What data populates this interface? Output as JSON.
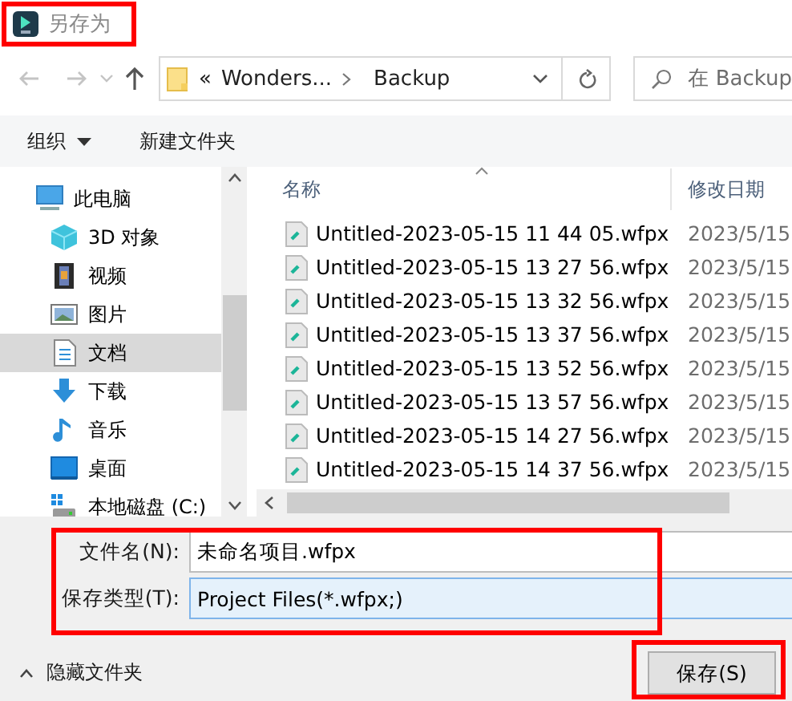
{
  "window": {
    "title": "另存为"
  },
  "navigation": {
    "overflow_marker": "«",
    "path": [
      "Wonders...",
      "Backup"
    ],
    "search": {
      "placeholder": "在 Backup"
    }
  },
  "toolbar": {
    "organize": "组织",
    "new_folder": "新建文件夹"
  },
  "sidebar": {
    "items": [
      {
        "label": "此电脑",
        "kind": "computer",
        "selected": false,
        "children": [
          {
            "label": "3D 对象",
            "kind": "cube",
            "selected": false
          },
          {
            "label": "视频",
            "kind": "video",
            "selected": false
          },
          {
            "label": "图片",
            "kind": "picture",
            "selected": false
          },
          {
            "label": "文档",
            "kind": "document",
            "selected": true
          },
          {
            "label": "下载",
            "kind": "download",
            "selected": false
          },
          {
            "label": "音乐",
            "kind": "music",
            "selected": false
          },
          {
            "label": "桌面",
            "kind": "desktop",
            "selected": false
          },
          {
            "label": "本地磁盘 (C:)",
            "kind": "drive",
            "selected": false
          }
        ]
      }
    ]
  },
  "file_list": {
    "columns": [
      "名称",
      "修改日期"
    ],
    "rows": [
      {
        "name": "Untitled-2023-05-15 11 44 05.wfpx",
        "modified": "2023/5/15"
      },
      {
        "name": "Untitled-2023-05-15 13 27 56.wfpx",
        "modified": "2023/5/15"
      },
      {
        "name": "Untitled-2023-05-15 13 32 56.wfpx",
        "modified": "2023/5/15"
      },
      {
        "name": "Untitled-2023-05-15 13 37 56.wfpx",
        "modified": "2023/5/15"
      },
      {
        "name": "Untitled-2023-05-15 13 52 56.wfpx",
        "modified": "2023/5/15"
      },
      {
        "name": "Untitled-2023-05-15 13 57 56.wfpx",
        "modified": "2023/5/15"
      },
      {
        "name": "Untitled-2023-05-15 14 27 56.wfpx",
        "modified": "2023/5/15"
      },
      {
        "name": "Untitled-2023-05-15 14 37 56.wfpx",
        "modified": "2023/5/15"
      }
    ]
  },
  "save_form": {
    "filename_label": "文件名(N):",
    "filename": "未命名项目.wfpx",
    "type_label": "保存类型(T):",
    "type": "Project Files(*.wfpx;)",
    "hide_folders": "隐藏文件夹",
    "save_button": "保存(S)"
  }
}
